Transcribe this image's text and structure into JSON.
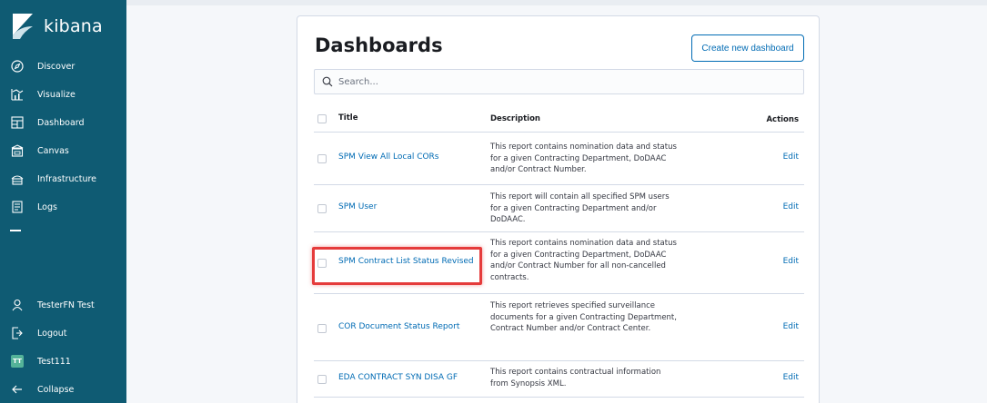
{
  "sidebar": {
    "brand": "kibana",
    "items": [
      {
        "label": "Discover",
        "icon": "compass-icon"
      },
      {
        "label": "Visualize",
        "icon": "visualize-icon"
      },
      {
        "label": "Dashboard",
        "icon": "dashboard-icon"
      },
      {
        "label": "Canvas",
        "icon": "canvas-icon"
      },
      {
        "label": "Infrastructure",
        "icon": "infrastructure-icon"
      },
      {
        "label": "Logs",
        "icon": "logs-icon"
      }
    ],
    "bottom_items": [
      {
        "label": "TesterFN Test",
        "icon": "user-icon"
      },
      {
        "label": "Logout",
        "icon": "logout-icon"
      },
      {
        "label": "Test111",
        "icon": "space-avatar-icon",
        "avatar_text": "TT"
      },
      {
        "label": "Collapse",
        "icon": "arrow-left-icon"
      }
    ]
  },
  "main": {
    "title": "Dashboards",
    "create_button": "Create new dashboard",
    "search_placeholder": "Search...",
    "columns": {
      "title": "Title",
      "description": "Description",
      "actions": "Actions"
    },
    "rows": [
      {
        "title": "SPM View All Local CORs",
        "description": "This report contains nomination data and status for a given Contracting Department, DoDAAC and/or Contract Number.",
        "action": "Edit"
      },
      {
        "title": "SPM User",
        "description": "This report will contain all specified SPM users for a given Contracting Department and/or DoDAAC.",
        "action": "Edit"
      },
      {
        "title": "SPM Contract List Status Revised",
        "description": "This report contains nomination data and status for a given Contracting Department, DoDAAC and/or Contract Number for all non-cancelled contracts.",
        "action": "Edit"
      },
      {
        "title": "COR Document Status Report",
        "description": "This report retrieves specified surveillance documents for a given Contracting Department, Contract Number and/or Contract Center.",
        "action": "Edit"
      },
      {
        "title": "EDA CONTRACT SYN DISA GF",
        "description": "This report contains contractual information from Synopsis XML.",
        "action": "Edit"
      }
    ]
  },
  "colors": {
    "sidebar_bg": "#0f5b73",
    "link": "#006bb4",
    "highlight": "#e53b3b",
    "avatar": "#54b399"
  }
}
